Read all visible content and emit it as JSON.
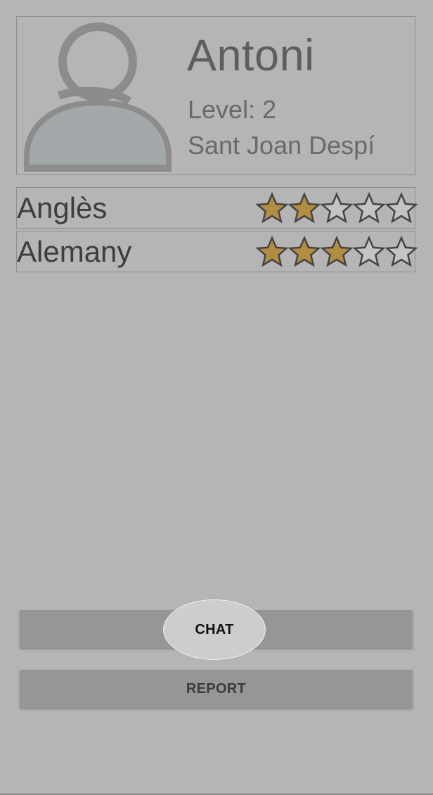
{
  "profile": {
    "name": "Antoni",
    "level": "Level: 2",
    "location": "Sant Joan Despí"
  },
  "languages": [
    {
      "name": "Anglès",
      "rating": 2,
      "max_rating": 5
    },
    {
      "name": "Alemany",
      "rating": 3,
      "max_rating": 5
    }
  ],
  "actions": {
    "chat_label": "CHAT",
    "report_label": "REPORT"
  },
  "colors": {
    "background": "#b5b5b5",
    "star_filled": "#b38d3f",
    "star_empty": "#c4c4c4",
    "star_outline": "#444444",
    "button": "#959796",
    "highlight": "#cdcdcd"
  },
  "icons": {
    "avatar": "user-avatar-icon",
    "star_filled": "star-filled-icon",
    "star_empty": "star-empty-icon"
  }
}
